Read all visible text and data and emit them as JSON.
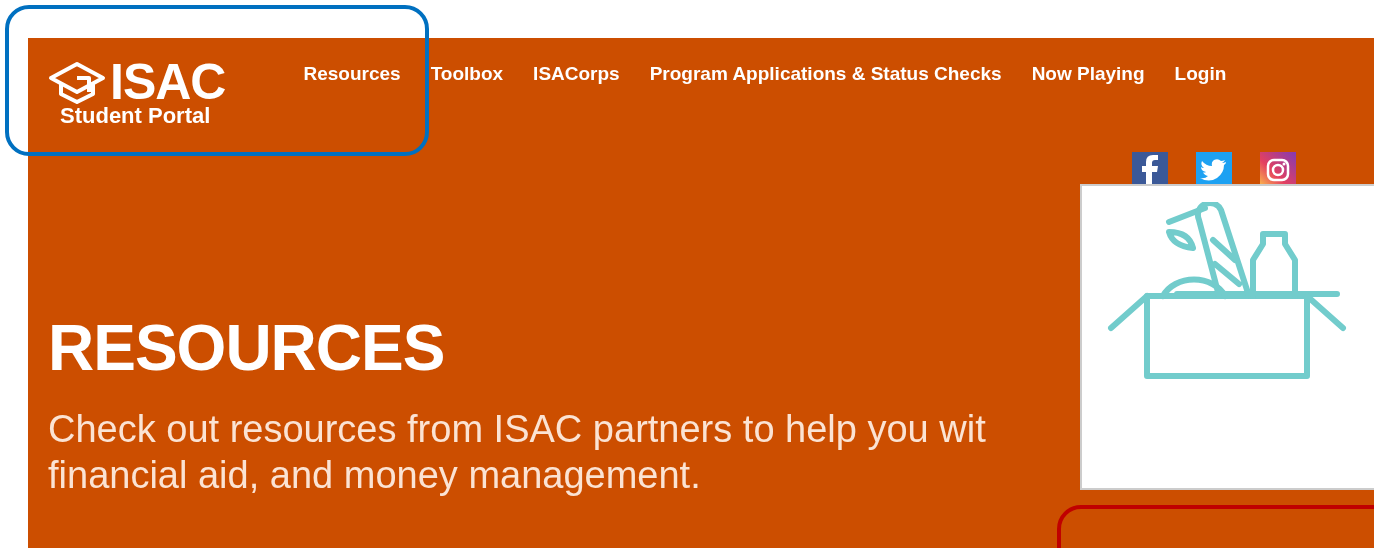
{
  "header": {
    "logo": {
      "wordmark": "ISAC",
      "subtitle": "Student Portal"
    },
    "nav": [
      {
        "label": "Resources"
      },
      {
        "label": "Toolbox"
      },
      {
        "label": "ISACorps"
      },
      {
        "label": "Program Applications & Status Checks"
      },
      {
        "label": "Now Playing"
      },
      {
        "label": "Login"
      }
    ],
    "social": [
      {
        "kind": "facebook"
      },
      {
        "kind": "twitter"
      },
      {
        "kind": "instagram"
      }
    ]
  },
  "hero": {
    "title": "RESOURCES",
    "lines": [
      "Check out resources from ISAC partners to help you wit",
      "financial aid, and money management."
    ]
  },
  "annotations": [
    {
      "color": "#0070c0"
    },
    {
      "color": "#c00000"
    }
  ]
}
